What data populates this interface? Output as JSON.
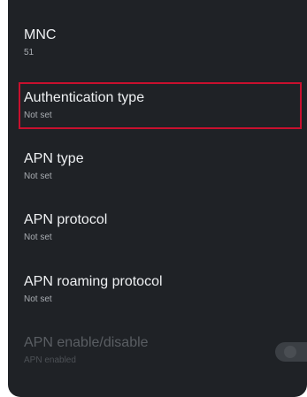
{
  "settings": {
    "mnc": {
      "title": "MNC",
      "summary": "51"
    },
    "auth_type": {
      "title": "Authentication type",
      "summary": "Not set"
    },
    "apn_type": {
      "title": "APN type",
      "summary": "Not set"
    },
    "apn_protocol": {
      "title": "APN protocol",
      "summary": "Not set"
    },
    "apn_roaming_protocol": {
      "title": "APN roaming protocol",
      "summary": "Not set"
    },
    "apn_enable": {
      "title": "APN enable/disable",
      "summary": "APN enabled",
      "enabled": false,
      "checked": true
    }
  },
  "colors": {
    "background": "#1f2226",
    "highlight": "#c8102e",
    "title_text": "#eef0f2",
    "summary_text": "#a9adb2"
  }
}
